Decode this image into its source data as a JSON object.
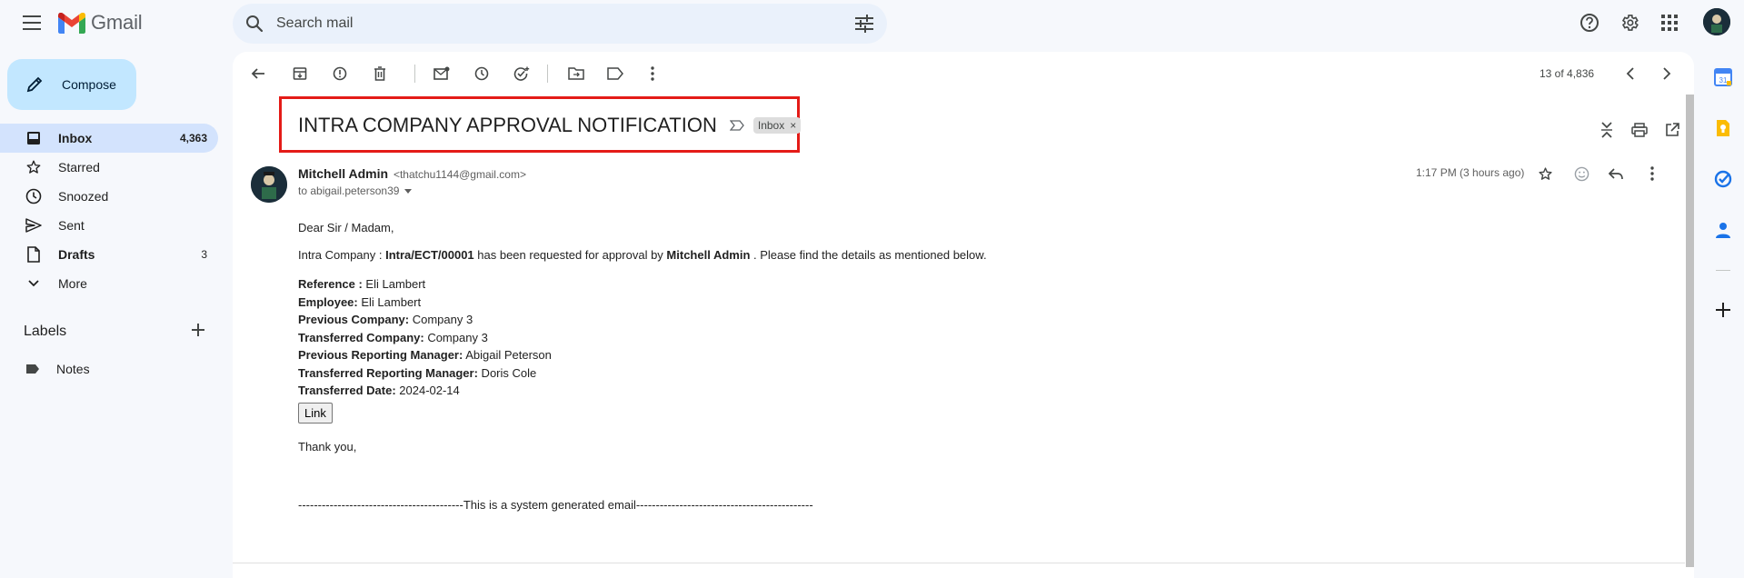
{
  "app": {
    "name": "Gmail"
  },
  "search": {
    "placeholder": "Search mail"
  },
  "compose": {
    "label": "Compose"
  },
  "nav": [
    {
      "label": "Inbox",
      "count": "4,363",
      "active": true
    },
    {
      "label": "Starred",
      "count": ""
    },
    {
      "label": "Snoozed",
      "count": ""
    },
    {
      "label": "Sent",
      "count": ""
    },
    {
      "label": "Drafts",
      "count": "3"
    },
    {
      "label": "More",
      "count": ""
    }
  ],
  "labels": {
    "heading": "Labels",
    "items": [
      {
        "label": "Notes"
      }
    ]
  },
  "pager": {
    "text": "13 of 4,836"
  },
  "email": {
    "subject": "INTRA COMPANY APPROVAL NOTIFICATION",
    "chip": "Inbox",
    "chip_close": "×",
    "sender_name": "Mitchell Admin",
    "sender_email": "<thatchu1144@gmail.com>",
    "to": "to abigail.peterson39",
    "time": "1:17 PM (3 hours ago)",
    "greeting": "Dear Sir / Madam,",
    "intro_prefix": "Intra Company : ",
    "intro_ref": "Intra/ECT/00001",
    "intro_mid": " has been requested for approval by ",
    "intro_by": "Mitchell Admin",
    "intro_suffix": " . Please find the details as mentioned below.",
    "details": [
      {
        "label": "Reference :",
        "value": " Eli Lambert"
      },
      {
        "label": "Employee:",
        "value": " Eli Lambert"
      },
      {
        "label": "Previous Company:",
        "value": " Company 3"
      },
      {
        "label": "Transferred Company:",
        "value": " Company 3"
      },
      {
        "label": "Previous Reporting Manager:",
        "value": " Abigail Peterson"
      },
      {
        "label": "Transferred Reporting Manager:",
        "value": " Doris Cole"
      },
      {
        "label": "Transferred Date:",
        "value": " 2024-02-14"
      }
    ],
    "link_label": "Link",
    "closing": "Thank you,",
    "footer": "------------------------------------------This is a system generated email---------------------------------------------"
  },
  "colors": {
    "accent": "#c2e7ff",
    "active_nav": "#d3e3fd",
    "highlight_box": "#e41b17"
  }
}
